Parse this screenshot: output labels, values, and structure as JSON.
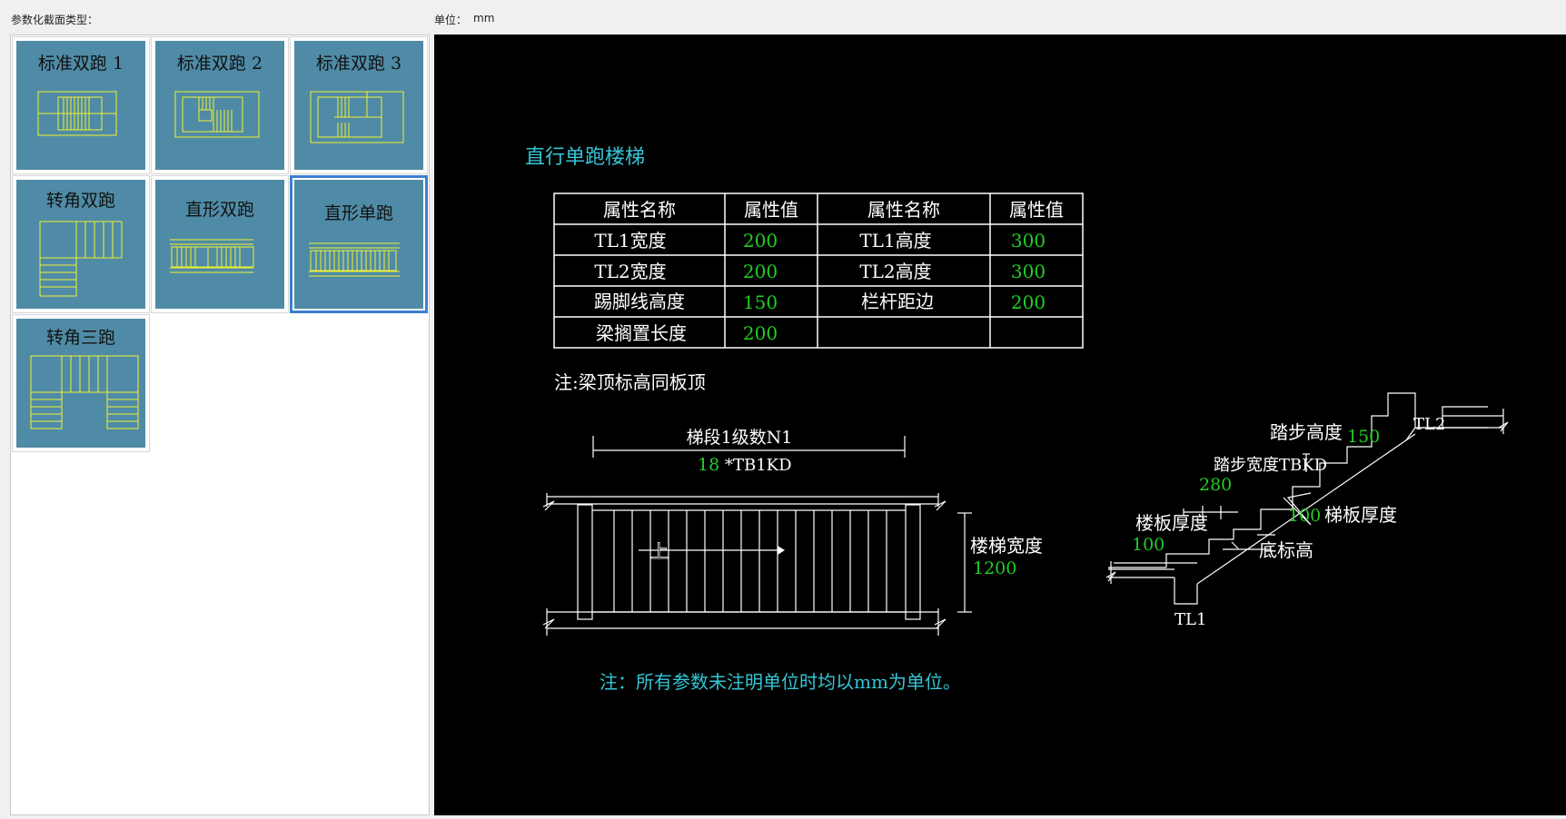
{
  "header": {
    "section_type_label": "参数化截面类型：",
    "unit_label": "单位：",
    "unit_value": "mm"
  },
  "thumbnails": [
    {
      "label": "标准双跑 1",
      "selected": false
    },
    {
      "label": "标准双跑 2",
      "selected": false
    },
    {
      "label": "标准双跑 3",
      "selected": false
    },
    {
      "label": "转角双跑",
      "selected": false
    },
    {
      "label": "直形双跑",
      "selected": false
    },
    {
      "label": "直形单跑",
      "selected": true
    },
    {
      "label": "转角三跑",
      "selected": false
    }
  ],
  "preview": {
    "title": "直行单跑楼梯",
    "table": {
      "headers": [
        "属性名称",
        "属性值",
        "属性名称",
        "属性值"
      ],
      "rows": [
        [
          "TL1宽度",
          "200",
          "TL1高度",
          "300"
        ],
        [
          "TL2宽度",
          "200",
          "TL2高度",
          "300"
        ],
        [
          "踢脚线高度",
          "150",
          "栏杆距边",
          "200"
        ],
        [
          "梁搁置长度",
          "200",
          "",
          ""
        ]
      ]
    },
    "note_beam": "注:梁顶标高同板顶",
    "plan": {
      "steps_label": "梯段1级数N1",
      "steps_count": "18",
      "steps_formula": "*TB1KD",
      "up_label": "上",
      "width_label": "楼梯宽度",
      "width_value": "1200"
    },
    "section": {
      "step_height_label": "踏步高度",
      "step_height_value": "150",
      "step_width_label": "踏步宽度TBKD",
      "step_width_value": "280",
      "slab_thickness_label": "楼板厚度",
      "slab_thickness_value": "100",
      "stair_thickness_value": "100",
      "stair_thickness_label": "梯板厚度",
      "bottom_elev_label": "底标高",
      "tl1": "TL1",
      "tl2": "TL2"
    },
    "note_units": "注：所有参数未注明单位时均以mm为单位。"
  },
  "colors": {
    "thumb_bg": "#4f8ba6",
    "thumb_lines": "#f2f230",
    "cad_bg": "#000000",
    "cad_lines": "#ffffff",
    "cad_title": "#33c6d6",
    "cad_values": "#22cc22",
    "selection": "#3b7fd1"
  }
}
